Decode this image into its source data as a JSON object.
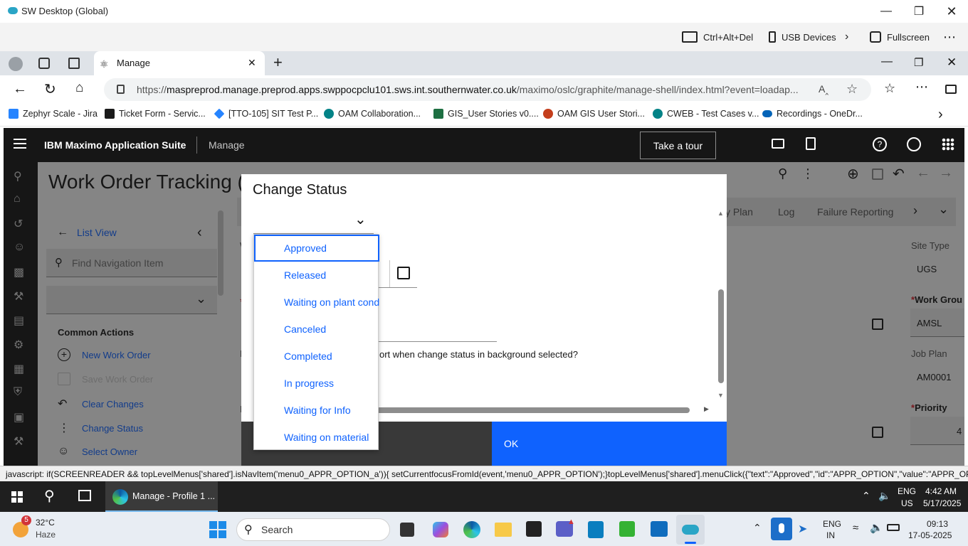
{
  "window": {
    "title": "SW Desktop (Global)"
  },
  "remote_toolbar": {
    "ctrl_alt_del": "Ctrl+Alt+Del",
    "usb_devices": "USB Devices",
    "fullscreen": "Fullscreen"
  },
  "browser": {
    "tab_title": "Manage",
    "url_prefix": "https://",
    "url_host": "maspreprod.manage.preprod.apps.swppocpclu101.sws.int.southernwater.co.uk",
    "url_path": "/maximo/oslc/graphite/manage-shell/index.html?event=loadap...",
    "bookmarks": [
      {
        "label": "Zephyr Scale - Jira",
        "color": "#2684ff"
      },
      {
        "label": "Ticket Form - Servic...",
        "color": "#1a1a1a"
      },
      {
        "label": "[TTO-105] SIT Test P...",
        "color": "#2684ff"
      },
      {
        "label": "OAM Collaboration...",
        "color": "#038387"
      },
      {
        "label": "GIS_User Stories v0....",
        "color": "#1d6f42"
      },
      {
        "label": "OAM GIS User Stori...",
        "color": "#c43e1c"
      },
      {
        "label": "CWEB - Test Cases v...",
        "color": "#038387"
      },
      {
        "label": "Recordings - OneDr...",
        "color": "#0364b8"
      }
    ]
  },
  "maximo": {
    "brand_prefix": "IBM",
    "brand_name": "Maximo Application Suite",
    "app_name": "Manage",
    "tour_button": "Take a tour",
    "page_title": "Work Order Tracking (",
    "nav": {
      "list_view": "List View",
      "find_placeholder": "Find Navigation Item",
      "common_actions": "Common Actions",
      "actions": [
        {
          "label": "New Work Order",
          "enabled": true
        },
        {
          "label": "Save Work Order",
          "enabled": false
        },
        {
          "label": "Clear Changes",
          "enabled": true
        },
        {
          "label": "Change Status",
          "enabled": true
        },
        {
          "label": "Select Owner",
          "enabled": true
        }
      ]
    },
    "tabs": [
      "y Plan",
      "Log",
      "Failure Reporting"
    ],
    "right_fields": {
      "site_type_label": "Site Type",
      "site_type_value": "UGS",
      "work_group_label": "Work Grou",
      "work_group_value": "AMSL",
      "job_plan_label": "Job Plan",
      "job_plan_value": "AM0001",
      "priority_label": "Priority",
      "priority_value": "4"
    },
    "bg_letters": {
      "w": "W",
      "p": "P",
      "n": "N"
    }
  },
  "modal": {
    "title": "Change Status",
    "select_value": "",
    "partial_text": "ort when change status in background selected?",
    "ok_label": "OK",
    "options": [
      "Approved",
      "Released",
      "Waiting on plant cond",
      "Canceled",
      "Completed",
      "In progress",
      "Waiting for Info",
      "Waiting on material"
    ],
    "selected_option": "Approved"
  },
  "status_text": "javascript: if(SCREENREADER && topLevelMenus['shared'].isNavItem('menu0_APPR_OPTION_a')){ setCurrentfocusFromId(event,'menu0_APPR_OPTION');}topLevelMenus['shared'].menuClick({\"text\":\"Approved\",\"id\":\"APPR_OPTION\",\"value\":\"APPR_OP...",
  "taskbar_remote": {
    "app_label": "Manage - Profile 1 ...",
    "lang": "ENG",
    "region": "US",
    "time": "4:42 AM",
    "date": "5/17/2025"
  },
  "taskbar_local": {
    "weather_temp": "32°C",
    "weather_desc": "Haze",
    "weather_badge": "5",
    "search_label": "Search",
    "lang": "ENG",
    "region": "IN",
    "time": "09:13",
    "date": "17-05-2025"
  }
}
